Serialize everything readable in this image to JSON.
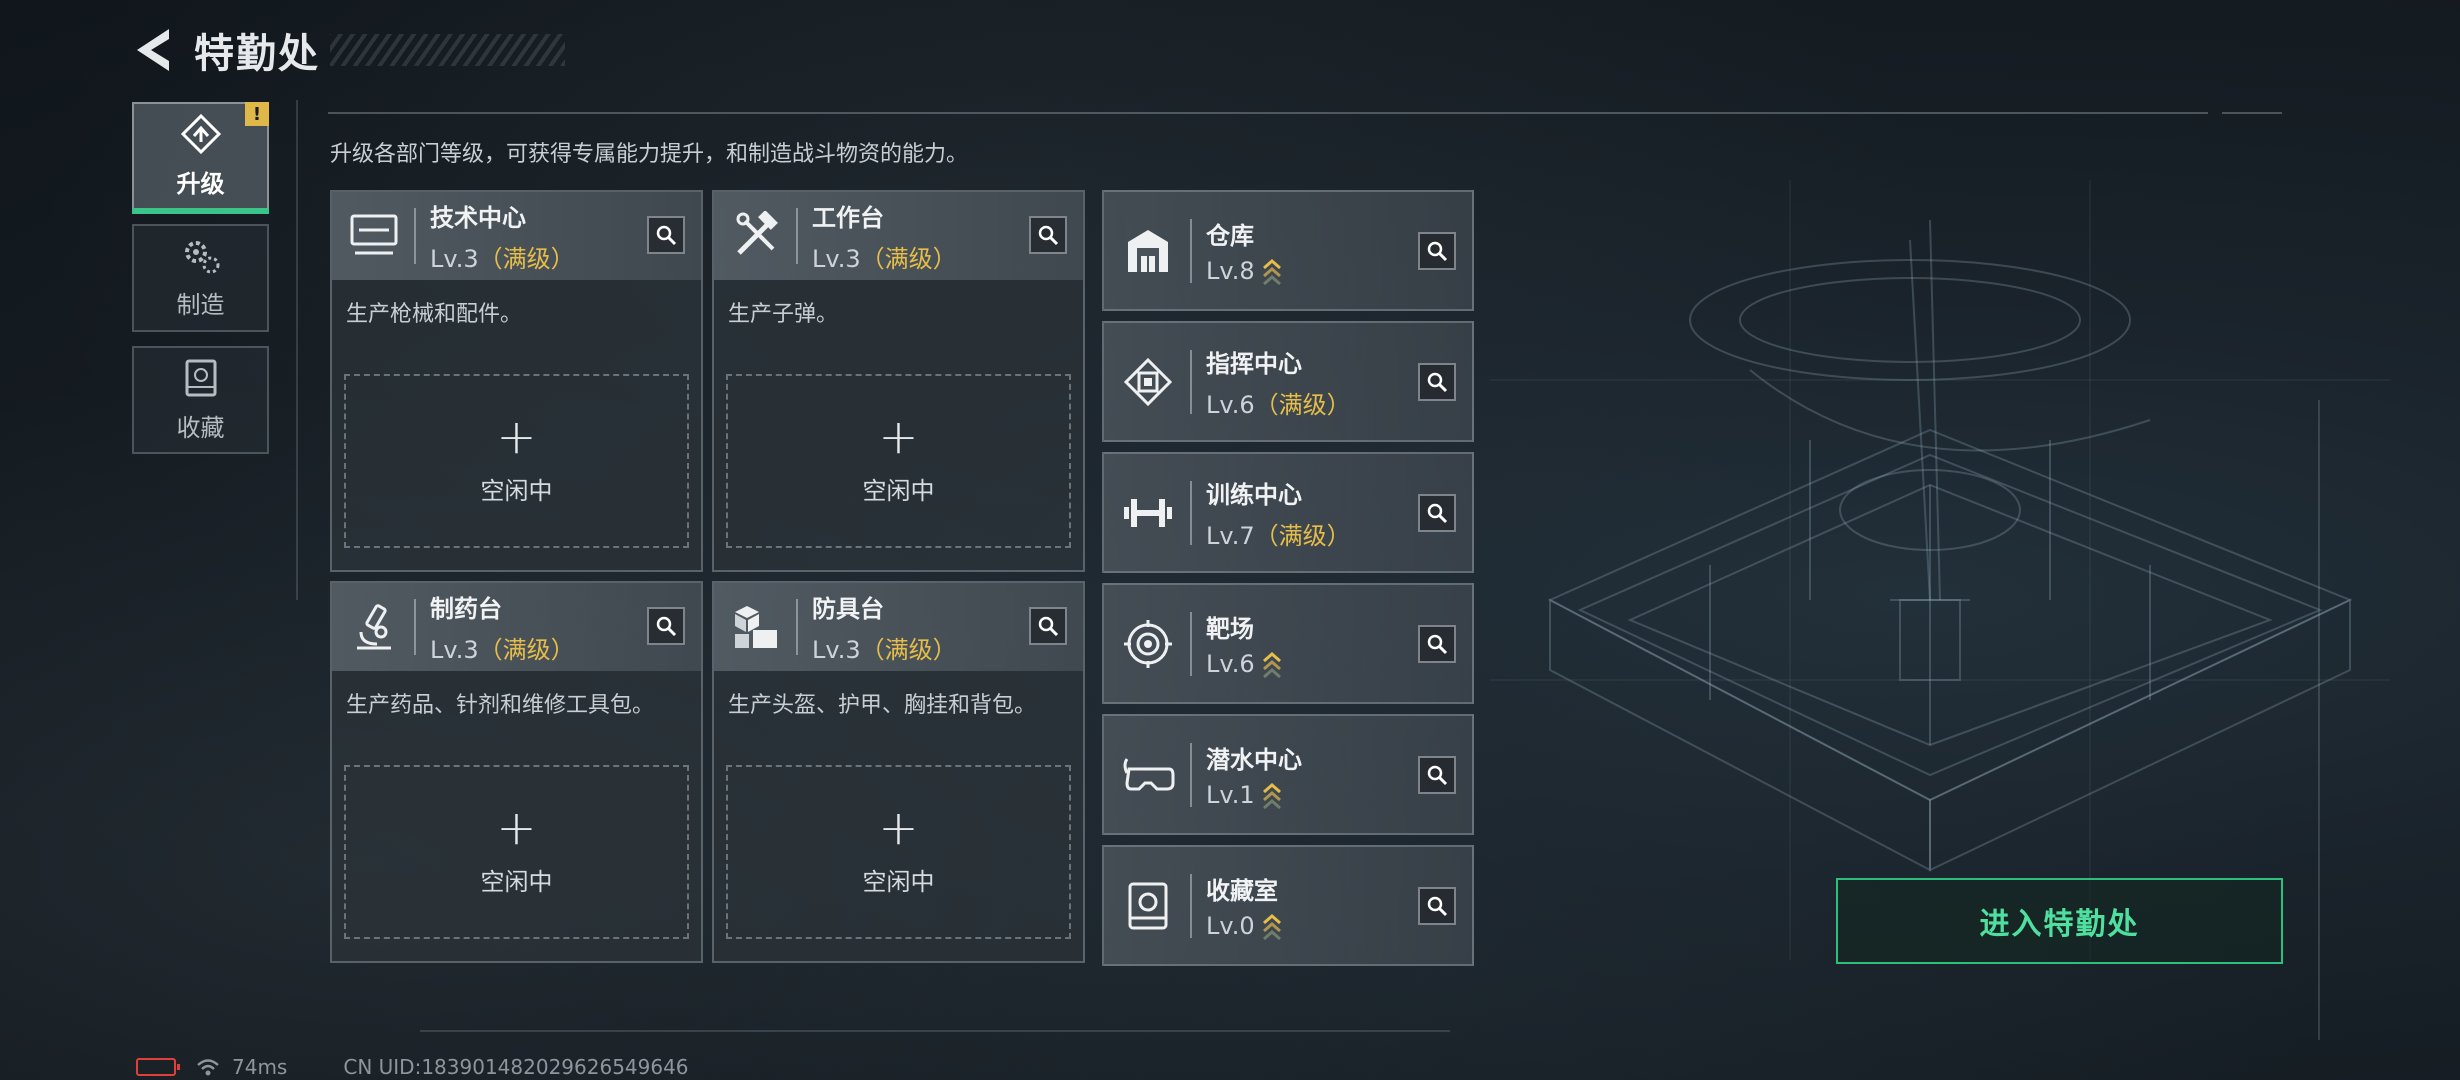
{
  "header": {
    "title": "特勤处"
  },
  "tabs": [
    {
      "label": "升级",
      "active": true,
      "badge": "!"
    },
    {
      "label": "制造"
    },
    {
      "label": "收藏"
    }
  ],
  "description": "升级各部门等级，可获得专属能力提升，和制造战斗物资的能力。",
  "workbenches": [
    {
      "name": "技术中心",
      "level": "Lv.3",
      "maxed": "（满级）",
      "desc": "生产枪械和配件。",
      "slot_plus": "+",
      "slot_status": "空闲中",
      "icon": "monitor-icon"
    },
    {
      "name": "工作台",
      "level": "Lv.3",
      "maxed": "（满级）",
      "desc": "生产子弹。",
      "slot_plus": "+",
      "slot_status": "空闲中",
      "icon": "tools-icon"
    },
    {
      "name": "制药台",
      "level": "Lv.3",
      "maxed": "（满级）",
      "desc": "生产药品、针剂和维修工具包。",
      "slot_plus": "+",
      "slot_status": "空闲中",
      "icon": "microscope-icon"
    },
    {
      "name": "防具台",
      "level": "Lv.3",
      "maxed": "（满级）",
      "desc": "生产头盔、护甲、胸挂和背包。",
      "slot_plus": "+",
      "slot_status": "空闲中",
      "icon": "boxes-icon"
    }
  ],
  "departments": [
    {
      "name": "仓库",
      "level": "Lv.8",
      "maxed": "",
      "upgradeable": true,
      "icon": "warehouse-icon"
    },
    {
      "name": "指挥中心",
      "level": "Lv.6",
      "maxed": "（满级）",
      "upgradeable": false,
      "icon": "chip-icon"
    },
    {
      "name": "训练中心",
      "level": "Lv.7",
      "maxed": "（满级）",
      "upgradeable": false,
      "icon": "dumbbell-icon"
    },
    {
      "name": "靶场",
      "level": "Lv.6",
      "maxed": "",
      "upgradeable": true,
      "icon": "target-icon"
    },
    {
      "name": "潜水中心",
      "level": "Lv.1",
      "maxed": "",
      "upgradeable": true,
      "icon": "goggles-icon"
    },
    {
      "name": "收藏室",
      "level": "Lv.0",
      "maxed": "",
      "upgradeable": true,
      "icon": "display-case-icon"
    }
  ],
  "enter_button": "进入特勤处",
  "status_bar": {
    "ping": "74ms",
    "uid": "CN UID:183901482029626549646"
  },
  "colors": {
    "accent_green": "#3ac48a",
    "maxed_gold": "#e7bd4a",
    "battery_red": "#e0403a"
  }
}
